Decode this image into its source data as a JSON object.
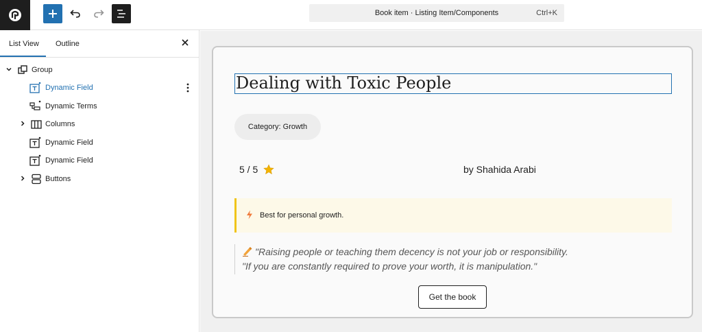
{
  "toolbar": {
    "logo_icon": "site-logo-icon",
    "add_icon": "plus-icon",
    "undo_icon": "undo-icon",
    "redo_icon": "redo-icon",
    "list_view_icon": "list-view-icon",
    "command_title": "Book item · Listing Item/Components",
    "command_shortcut": "Ctrl+K",
    "accent": "#2271b1"
  },
  "sidebar": {
    "tabs": [
      {
        "label": "List View",
        "active": true
      },
      {
        "label": "Outline",
        "active": false
      }
    ],
    "close_icon": "close-icon",
    "tree": [
      {
        "label": "Group",
        "icon": "group-icon",
        "expanded": true,
        "depth": 0
      },
      {
        "label": "Dynamic Field",
        "icon": "dynamic-field-icon",
        "depth": 1,
        "selected": true
      },
      {
        "label": "Dynamic Terms",
        "icon": "dynamic-terms-icon",
        "depth": 1
      },
      {
        "label": "Columns",
        "icon": "columns-icon",
        "expandable": true,
        "depth": 1
      },
      {
        "label": "Dynamic Field",
        "icon": "dynamic-field-icon",
        "depth": 1
      },
      {
        "label": "Dynamic Field",
        "icon": "dynamic-field-icon",
        "depth": 1
      },
      {
        "label": "Buttons",
        "icon": "buttons-icon",
        "expandable": true,
        "depth": 1
      }
    ]
  },
  "card": {
    "title": "Dealing with Toxic People",
    "category": "Category: Growth",
    "rating": "5 / 5",
    "rating_icon": "star-icon",
    "author": "by Shahida Arabi",
    "note_icon": "lightning-icon",
    "note": "Best for personal growth.",
    "quote_icon": "writing-hand-icon",
    "quote_line1": "\"Raising people or teaching them decency is not your job or responsibility.",
    "quote_line2": "\"If you are constantly required to prove your worth, it is manipulation.\"",
    "button": "Get the book",
    "note_accent": "#f0c419"
  }
}
